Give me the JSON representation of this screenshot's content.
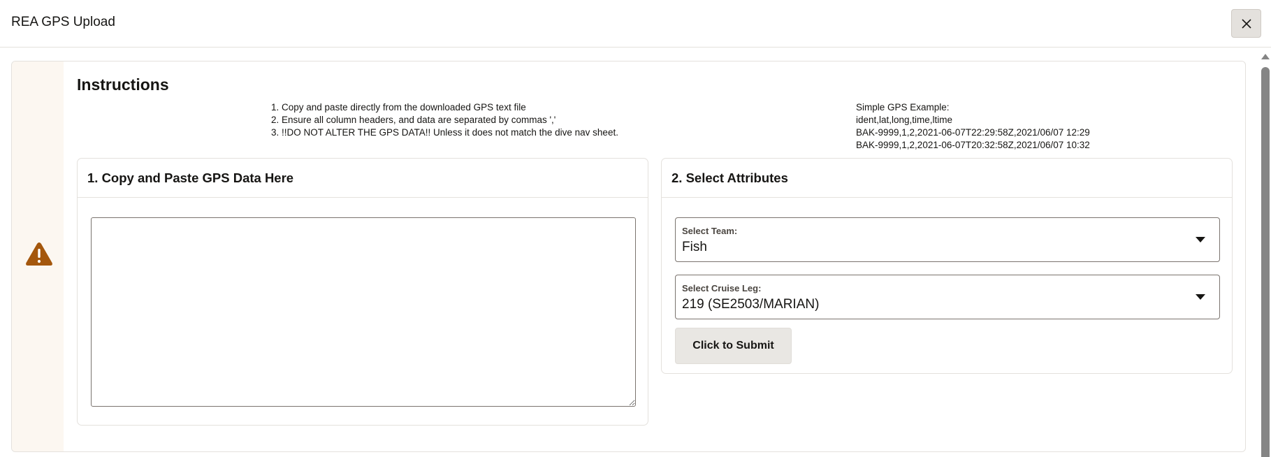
{
  "dialog": {
    "title": "REA GPS Upload",
    "close_icon": "close-icon"
  },
  "instructions": {
    "title": "Instructions",
    "warning_icon": "warning-icon",
    "steps": [
      "1. Copy and paste directly from the downloaded GPS text file",
      "2. Ensure all column headers, and data are separated by commas ','",
      "3. !!DO NOT ALTER THE GPS DATA!! Unless it does not match the dive nav sheet."
    ],
    "example": {
      "heading": "Simple GPS Example:",
      "lines": [
        "ident,lat,long,time,ltime",
        "BAK-9999,1,2,2021-06-07T22:29:58Z,2021/06/07 12:29",
        "BAK-9999,1,2,2021-06-07T20:32:58Z,2021/06/07 10:32"
      ]
    }
  },
  "paste_panel": {
    "title": "1. Copy and Paste GPS Data Here",
    "value": "",
    "placeholder": ""
  },
  "attributes_panel": {
    "title": "2. Select Attributes",
    "team": {
      "label": "Select Team:",
      "value": "Fish"
    },
    "cruise_leg": {
      "label": "Select Cruise Leg:",
      "value": "219 (SE2503/MARIAN)"
    },
    "submit_label": "Click to Submit"
  },
  "colors": {
    "warning": "#a4570d",
    "warning_bg": "#fcf7f1",
    "border": "#e4e1dd",
    "scroll_thumb": "#858585"
  }
}
